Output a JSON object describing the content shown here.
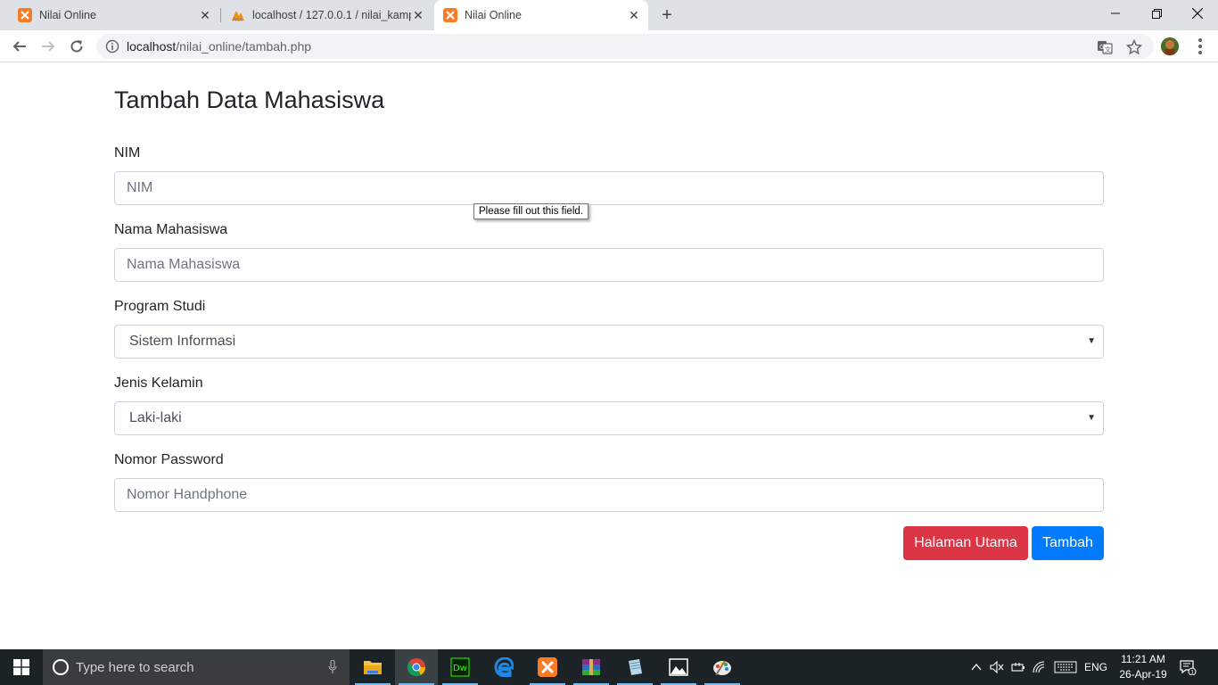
{
  "browser": {
    "tabs": [
      {
        "title": "Nilai Online",
        "favicon": "xampp-icon",
        "active": false
      },
      {
        "title": "localhost / 127.0.0.1 / nilai_kamp",
        "favicon": "phpmyadmin-icon",
        "active": false
      },
      {
        "title": "Nilai Online",
        "favicon": "xampp-icon",
        "active": true
      }
    ],
    "url": {
      "host": "localhost",
      "path": "/nilai_online/tambah.php"
    }
  },
  "page": {
    "title": "Tambah Data Mahasiswa",
    "fields": {
      "nim": {
        "label": "NIM",
        "placeholder": "NIM",
        "value": ""
      },
      "nama": {
        "label": "Nama Mahasiswa",
        "placeholder": "Nama Mahasiswa",
        "value": ""
      },
      "prodi": {
        "label": "Program Studi",
        "selected": "Sistem Informasi"
      },
      "jk": {
        "label": "Jenis Kelamin",
        "selected": "Laki-laki"
      },
      "password": {
        "label": "Nomor Password",
        "placeholder": "Nomor Handphone",
        "value": ""
      }
    },
    "tooltip": "Please fill out this field.",
    "buttons": {
      "back": "Halaman Utama",
      "submit": "Tambah"
    }
  },
  "colors": {
    "danger": "#dc3545",
    "primary": "#007bff",
    "xampp": "#fb7a24"
  },
  "taskbar": {
    "search_placeholder": "Type here to search",
    "language": "ENG",
    "time": "11:21 AM",
    "date": "26-Apr-19",
    "notification_count": "1"
  }
}
